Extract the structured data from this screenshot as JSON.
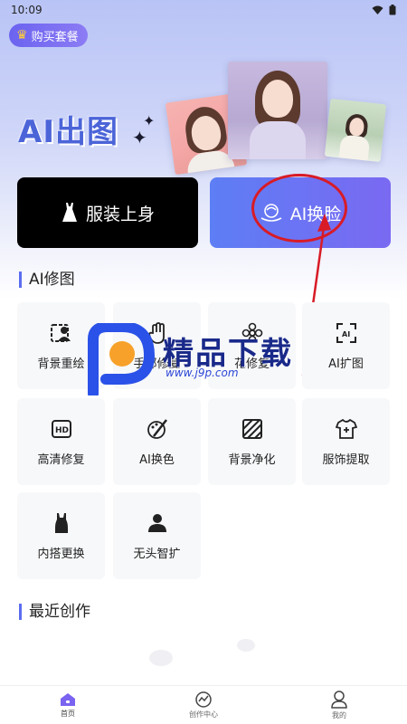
{
  "status_bar": {
    "time": "10:09"
  },
  "header": {
    "buy_label": "购买套餐"
  },
  "hero": {
    "title": "AI出图"
  },
  "primary_actions": {
    "clothes_label": "服装上身",
    "face_swap_label": "AI换脸"
  },
  "ai_edit": {
    "title": "AI修图",
    "tools": [
      {
        "label": "背景重绘",
        "icon": "background-redraw-icon"
      },
      {
        "label": "手部修复",
        "icon": "hand-icon"
      },
      {
        "label": "花修复",
        "icon": "flower-icon"
      },
      {
        "label": "AI扩图",
        "icon": "ai-expand-icon"
      },
      {
        "label": "高清修复",
        "icon": "hd-icon"
      },
      {
        "label": "AI换色",
        "icon": "color-swap-icon"
      },
      {
        "label": "背景净化",
        "icon": "background-clean-icon"
      },
      {
        "label": "服饰提取",
        "icon": "garment-extract-icon"
      },
      {
        "label": "内搭更换",
        "icon": "inner-wear-icon"
      },
      {
        "label": "无头智扩",
        "icon": "headless-expand-icon"
      }
    ]
  },
  "recent": {
    "title": "最近创作"
  },
  "watermark": {
    "text": "精品下载",
    "url": "www.j9p.com"
  },
  "tabbar": {
    "items": [
      {
        "label": "首页",
        "icon": "home-icon",
        "active": true
      },
      {
        "label": "创作中心",
        "icon": "creation-center-icon",
        "active": false
      },
      {
        "label": "我的",
        "icon": "profile-icon",
        "active": false
      }
    ]
  },
  "colors": {
    "accent": "#5b6df0",
    "face_swap_gradient_start": "#5d7ef5",
    "face_swap_gradient_end": "#7a69f2",
    "annotation_red": "#d81b26"
  }
}
